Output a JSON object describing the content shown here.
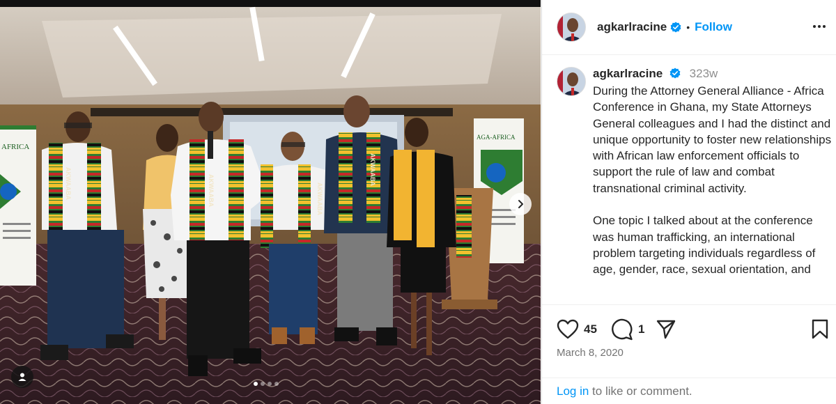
{
  "post": {
    "username": "agkarlracine",
    "verified": true,
    "follow_label": "Follow",
    "separator": "•",
    "time_ago": "323w",
    "caption": "During the Attorney General Alliance - Africa Conference in Ghana, my State Attorneys General colleagues and I had the distinct and unique opportunity to foster new relationships with African law enforcement officials to support the rule of law and combat transnational criminal activity.\n\nOne topic I talked about at the conference was human trafficking, an international problem targeting individuals regardless of age, gender, race, sexual orientation, and",
    "likes": "45",
    "comments": "1",
    "date": "March 8, 2020",
    "login_label": "Log in",
    "login_suffix": " to like or comment."
  },
  "carousel": {
    "total_slides": 4,
    "active_index": 0
  },
  "photo_banners": {
    "left_banner_text": "AFRICA",
    "right_banner_text": "AGA-AFRICA",
    "scarf_text": "AKWAABA"
  },
  "colors": {
    "accent_blue": "#0095f6",
    "verified_blue": "#0095f6",
    "text_primary": "#262626",
    "text_secondary": "#737373"
  },
  "icons": {
    "more": "more-options-icon",
    "like": "heart-icon",
    "comment": "comment-icon",
    "share": "share-icon",
    "save": "bookmark-icon",
    "next": "chevron-right-icon",
    "tag": "user-tag-icon"
  }
}
